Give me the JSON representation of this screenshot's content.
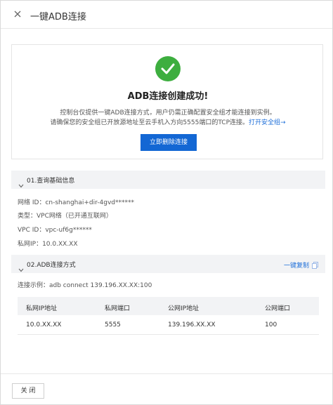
{
  "header": {
    "title": "一键ADB连接"
  },
  "success": {
    "title": "ADB连接创建成功!",
    "line1": "控制台仅提供一键ADB连接方式，用户仍需正确配置安全组才能连接到实例。",
    "line2": "请确保您的安全组已开放源地址至云手机入方向5555端口的TCP连接。",
    "link": "打开安全组→",
    "delete_button": "立即删除连接"
  },
  "basic_info": {
    "title": "01.查询基础信息",
    "rows": [
      "网络 ID：cn-shanghai+dir-4gvd******",
      "类型：VPC网络（已开通互联网）",
      "VPC ID：vpc-uf6g******",
      "私网IP：10.0.XX.XX"
    ]
  },
  "adb": {
    "title": "02.ADB连接方式",
    "copy_label": "一键复制",
    "example": "连接示例：adb connect 139.196.XX.XX:100",
    "columns": [
      "私网IP地址",
      "私网端口",
      "公网IP地址",
      "公网端口"
    ],
    "row": [
      "10.0.XX.XX",
      "5555",
      "139.196.XX.XX",
      "100"
    ]
  },
  "footer": {
    "close_label": "关 闭"
  },
  "colors": {
    "primary": "#1367d4",
    "success": "#3dae3f",
    "link": "#1e6fd9"
  }
}
